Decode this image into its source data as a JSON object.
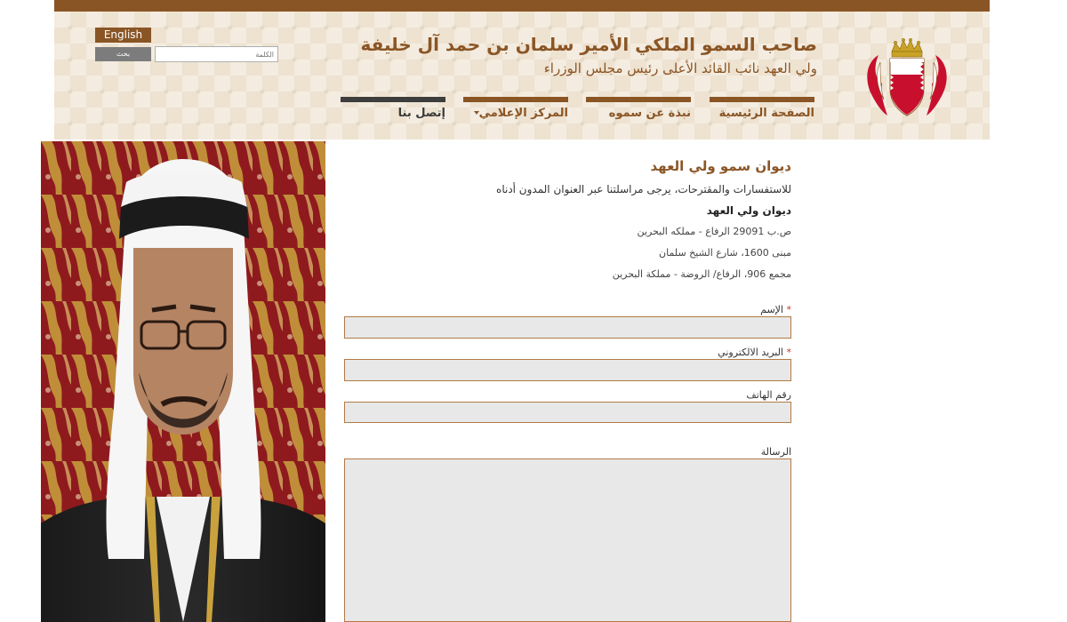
{
  "header": {
    "language_button": "English",
    "search_button": "بحث",
    "search_placeholder": "الكلمة",
    "title": "صاحب السمو الملكي الأمير سلمان بن حمد آل خليفة",
    "subtitle": "ولي العهد نائب القائد الأعلى رئيس مجلس الوزراء"
  },
  "nav": {
    "items": [
      {
        "label": "الصفحة الرئيسية"
      },
      {
        "label": "نبذة عن سموه"
      },
      {
        "label": "المركز الإعلامي"
      },
      {
        "label": "إتصل بنا"
      }
    ]
  },
  "contact": {
    "heading": "ديوان سمو ولي العهد",
    "intro": "للاستفسارات والمقترحات، يرجى مراسلتنا عبر العنوان المدون أدناه",
    "office": "ديوان ولي العهد",
    "po_box": "ص.ب 29091 الرفاع - مملكه البحرين",
    "building": "مبنى 1600، شارع الشيخ سلمان",
    "block": "مجمع 906، الرفاع/ الروضة - مملكة البحرين"
  },
  "form": {
    "required_mark": "*",
    "name_label": "الإسم",
    "email_label": "البريد الالكتروني",
    "phone_label": "رقم الهاتف",
    "message_label": "الرسالة",
    "name_value": "",
    "email_value": "",
    "phone_value": "",
    "message_value": ""
  },
  "icons": {
    "emblem": "bahrain-coat-of-arms-icon",
    "dropdown": "chevron-down-icon"
  },
  "colors": {
    "brand": "#8a5525",
    "header_bg": "#f4ece0",
    "field_bg": "#e8e8e8",
    "required": "#c0392b"
  }
}
